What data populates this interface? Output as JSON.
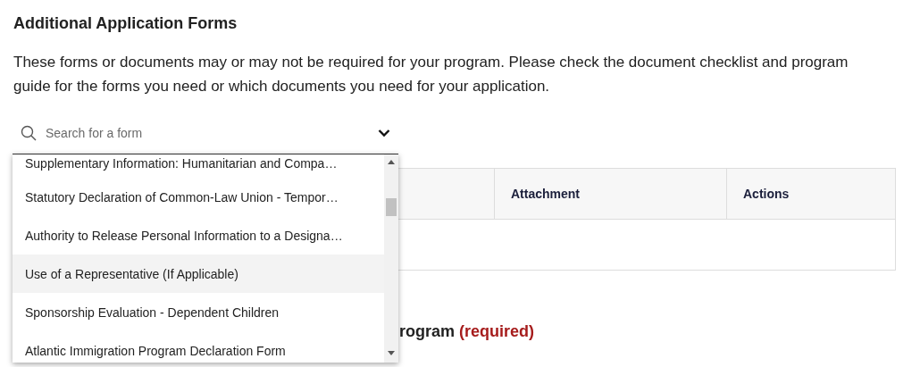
{
  "title": "Additional Application Forms",
  "description": "These forms or documents may or may not be required for your program. Please check the document checklist and program guide for the forms you need or which documents you need for your application.",
  "search": {
    "placeholder": "Search for a form"
  },
  "dropdown": {
    "options": [
      {
        "label": "Supplementary Information: Humanitarian and Compa…",
        "selected": false
      },
      {
        "label": "Statutory Declaration of Common-Law Union - Tempor…",
        "selected": false
      },
      {
        "label": "Authority to Release Personal Information to a Designa…",
        "selected": false
      },
      {
        "label": "Use of a Representative (If Applicable)",
        "selected": true
      },
      {
        "label": "Sponsorship Evaluation - Dependent Children",
        "selected": false
      },
      {
        "label": "Atlantic Immigration Program Declaration Form",
        "selected": false
      }
    ]
  },
  "table": {
    "columns": [
      "",
      "Attachment",
      "Actions"
    ]
  },
  "next_section": {
    "title": "rogram",
    "tag": "(required)"
  }
}
